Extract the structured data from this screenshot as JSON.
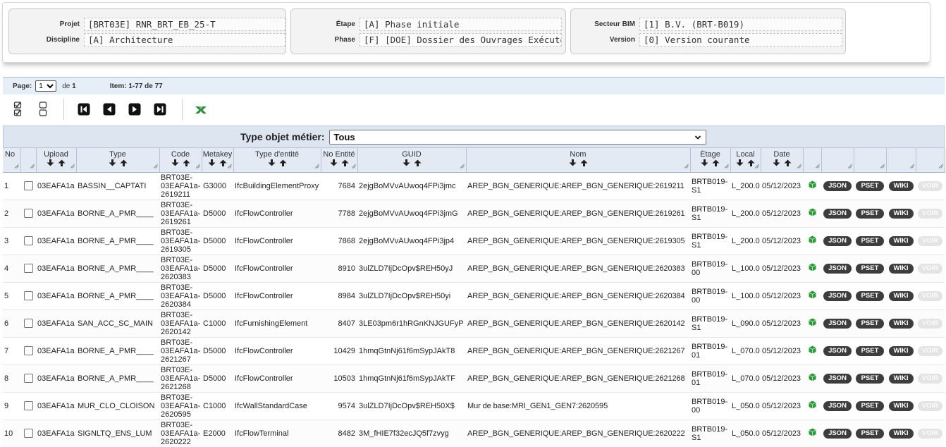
{
  "project": {
    "projet_label": "Projet",
    "projet_value": "[BRT03E] RNR_BRT_EB_25-T",
    "discipline_label": "Discipline",
    "discipline_value": "[A] Architecture",
    "etape_label": "Étape",
    "etape_value": "[A] Phase initiale",
    "phase_label": "Phase",
    "phase_value": "[F] [DOE] Dossier des Ouvrages Exécutés",
    "secteur_label": "Secteur BIM",
    "secteur_value": "[1] B.V. (BRT-B019)",
    "version_label": "Version",
    "version_value": "[0] Version courante"
  },
  "pager": {
    "page_label": "Page:",
    "page_value": "1",
    "of_label": "de",
    "total_pages": "1",
    "items_text": "Item: 1-77 de 77"
  },
  "toolbar": {
    "icons": [
      "check-all-icon",
      "uncheck-all-icon",
      "first-page-icon",
      "previous-page-icon",
      "next-page-icon",
      "last-page-icon",
      "excel-export-icon"
    ]
  },
  "filter": {
    "label": "Type objet métier:",
    "value": "Tous"
  },
  "columns": {
    "no": "No",
    "upload": "Upload",
    "type": "Type",
    "code": "Code",
    "metakey": "Metakey",
    "type_entite": "Type d'entité",
    "no_entite": "No Entité",
    "guid": "GUID",
    "nom": "Nom",
    "etage": "Étage",
    "local": "Local",
    "date": "Date"
  },
  "buttons": {
    "json": "JSON",
    "pset": "PSET",
    "wiki": "WIKI",
    "voir": "VOIR"
  },
  "rows": [
    {
      "no": "1",
      "upload": "03EAFA1a",
      "type": "BASSIN__CAPTATI",
      "code": "BRT03E-03EAFA1a-2619211",
      "metakey": "G3000",
      "type_entite": "IfcBuildingElementProxy",
      "no_entite": "7684",
      "guid": "2ejgBoMVvAUwoq4FPi3jmc",
      "nom": "AREP_BGN_GENERIQUE:AREP_BGN_GENERIQUE:2619211",
      "etage": "BRTB019-S1",
      "local": "L_200.0",
      "date": "05/12/2023"
    },
    {
      "no": "2",
      "upload": "03EAFA1a",
      "type": "BORNE_A_PMR____",
      "code": "BRT03E-03EAFA1a-2619261",
      "metakey": "D5000",
      "type_entite": "IfcFlowController",
      "no_entite": "7788",
      "guid": "2ejgBoMVvAUwoq4FPi3jmG",
      "nom": "AREP_BGN_GENERIQUE:AREP_BGN_GENERIQUE:2619261",
      "etage": "BRTB019-S1",
      "local": "L_200.0",
      "date": "05/12/2023"
    },
    {
      "no": "3",
      "upload": "03EAFA1a",
      "type": "BORNE_A_PMR____",
      "code": "BRT03E-03EAFA1a-2619305",
      "metakey": "D5000",
      "type_entite": "IfcFlowController",
      "no_entite": "7868",
      "guid": "2ejgBoMVvAUwoq4FPi3jp4",
      "nom": "AREP_BGN_GENERIQUE:AREP_BGN_GENERIQUE:2619305",
      "etage": "BRTB019-S1",
      "local": "L_200.0",
      "date": "05/12/2023"
    },
    {
      "no": "4",
      "upload": "03EAFA1a",
      "type": "BORNE_A_PMR____",
      "code": "BRT03E-03EAFA1a-2620383",
      "metakey": "D5000",
      "type_entite": "IfcFlowController",
      "no_entite": "8910",
      "guid": "3ulZLD7IjDcOpv$REH50yJ",
      "nom": "AREP_BGN_GENERIQUE:AREP_BGN_GENERIQUE:2620383",
      "etage": "BRTB019-00",
      "local": "L_100.0",
      "date": "05/12/2023"
    },
    {
      "no": "5",
      "upload": "03EAFA1a",
      "type": "BORNE_A_PMR____",
      "code": "BRT03E-03EAFA1a-2620384",
      "metakey": "D5000",
      "type_entite": "IfcFlowController",
      "no_entite": "8984",
      "guid": "3ulZLD7IjDcOpv$REH50yi",
      "nom": "AREP_BGN_GENERIQUE:AREP_BGN_GENERIQUE:2620384",
      "etage": "BRTB019-00",
      "local": "L_100.0",
      "date": "05/12/2023"
    },
    {
      "no": "6",
      "upload": "03EAFA1a",
      "type": "SAN_ACC_SC_MAIN",
      "code": "BRT03E-03EAFA1a-2620142",
      "metakey": "C1000",
      "type_entite": "IfcFurnishingElement",
      "no_entite": "8407",
      "guid": "3LE03pm6r1hRGnKNJGUFyP",
      "nom": "AREP_BGN_GENERIQUE:AREP_BGN_GENERIQUE:2620142",
      "etage": "BRTB019-S1",
      "local": "L_090.0",
      "date": "05/12/2023"
    },
    {
      "no": "7",
      "upload": "03EAFA1a",
      "type": "BORNE_A_PMR____",
      "code": "BRT03E-03EAFA1a-2621267",
      "metakey": "D5000",
      "type_entite": "IfcFlowController",
      "no_entite": "10429",
      "guid": "1hmqGtnNj61f6mSypJAkT8",
      "nom": "AREP_BGN_GENERIQUE:AREP_BGN_GENERIQUE:2621267",
      "etage": "BRTB019-01",
      "local": "L_070.0",
      "date": "05/12/2023"
    },
    {
      "no": "8",
      "upload": "03EAFA1a",
      "type": "BORNE_A_PMR____",
      "code": "BRT03E-03EAFA1a-2621268",
      "metakey": "D5000",
      "type_entite": "IfcFlowController",
      "no_entite": "10503",
      "guid": "1hmqGtnNj61f6mSypJAkTF",
      "nom": "AREP_BGN_GENERIQUE:AREP_BGN_GENERIQUE:2621268",
      "etage": "BRTB019-01",
      "local": "L_070.0",
      "date": "05/12/2023"
    },
    {
      "no": "9",
      "upload": "03EAFA1a",
      "type": "MUR_CLO_CLOISON",
      "code": "BRT03E-03EAFA1a-2620595",
      "metakey": "C1000",
      "type_entite": "IfcWallStandardCase",
      "no_entite": "9574",
      "guid": "3ulZLD7IjDcOpv$REH50X$",
      "nom": "Mur de base:MRI_GEN1_GEN7:2620595",
      "etage": "BRTB019-00",
      "local": "L_050.0",
      "date": "05/12/2023"
    },
    {
      "no": "10",
      "upload": "03EAFA1a",
      "type": "SIGNLTQ_ENS_LUM",
      "code": "BRT03E-03EAFA1a-2620222",
      "metakey": "E2000",
      "type_entite": "IfcFlowTerminal",
      "no_entite": "8482",
      "guid": "3M_fHIE7f32ecJQ5f7zvyg",
      "nom": "AREP_BGN_GENERIQUE:AREP_BGN_GENERIQUE:2620222",
      "etage": "BRTB019-S1",
      "local": "L_050.0",
      "date": "05/12/2023"
    }
  ]
}
